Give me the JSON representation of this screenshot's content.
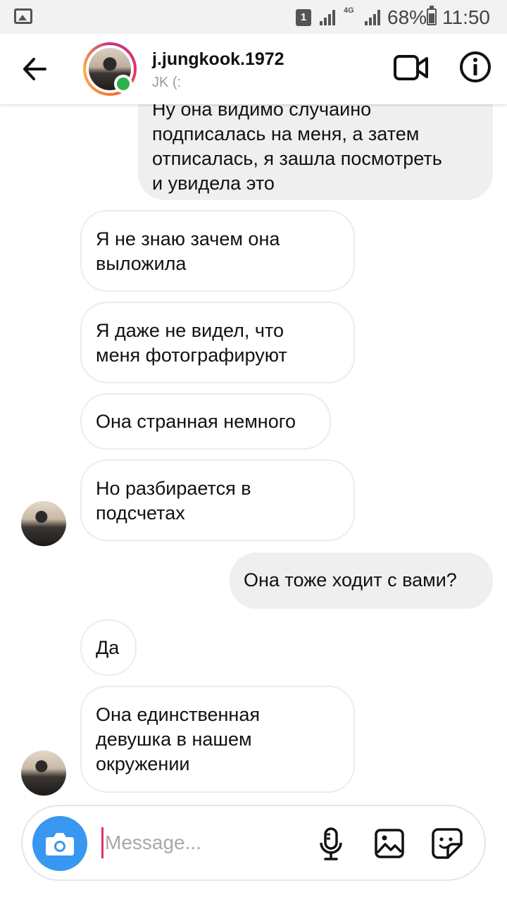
{
  "status_bar": {
    "sim": "1",
    "network": "4G",
    "battery": "68%",
    "time": "11:50"
  },
  "header": {
    "username": "j.jungkook.1972",
    "subtitle": "JK (:"
  },
  "messages": [
    {
      "side": "out",
      "text": "Ну она видимо случайно\nподписалась  на меня, а затем\nотписалась, я зашла посмотреть\nи увидела это"
    },
    {
      "side": "in",
      "text": "Я не знаю зачем она\nвыложила"
    },
    {
      "side": "in",
      "text": "Я даже не видел, что\nменя фотографируют"
    },
    {
      "side": "in",
      "text": "Она странная немного"
    },
    {
      "side": "in",
      "text": "Но разбирается в\nподсчетах"
    },
    {
      "side": "out",
      "text": "Она тоже ходит с вами?"
    },
    {
      "side": "in",
      "text": "Да"
    },
    {
      "side": "in",
      "text": "Она единственная\nдевушка в нашем\nокружении"
    }
  ],
  "composer": {
    "placeholder": "Message..."
  },
  "colors": {
    "accent": "#3897f0",
    "online": "#2bb24c",
    "outgoing_bubble": "#efefef"
  }
}
